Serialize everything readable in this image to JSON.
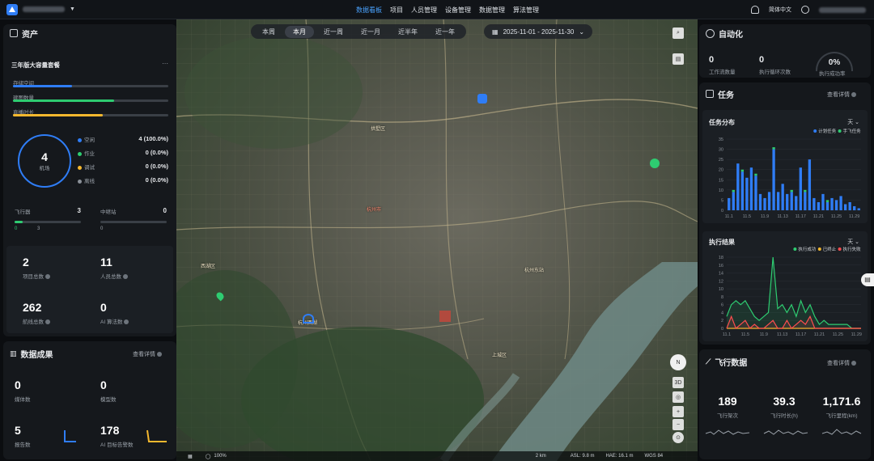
{
  "nav": {
    "items": [
      "数据看板",
      "项目",
      "人员管理",
      "设备管理",
      "数据管理",
      "算法管理"
    ],
    "active_index": 0,
    "language": "简体中文"
  },
  "time_filter": {
    "tabs": [
      "本周",
      "本月",
      "近一周",
      "近一月",
      "近半年",
      "近一年"
    ],
    "active_index": 1,
    "date_range": "2025-11-01 - 2025-11-30"
  },
  "assets": {
    "title": "资产",
    "package_name": "三年版大容量套餐",
    "storage": [
      {
        "label": "存储空间",
        "color": "#2f7df6",
        "fraction": 0.38
      },
      {
        "label": "建图数量",
        "color": "#2ecc71",
        "fraction": 0.65
      },
      {
        "label": "直播时长",
        "color": "#f5b82e",
        "fraction": 0.58
      }
    ],
    "airport_count": "4",
    "airport_label": "机场",
    "status": [
      {
        "label": "空闲",
        "value": "4 (100.0%)",
        "color": "#2f7df6"
      },
      {
        "label": "作业",
        "value": "0 (0.0%)",
        "color": "#2ecc71"
      },
      {
        "label": "调试",
        "value": "0 (0.0%)",
        "color": "#f5b82e"
      },
      {
        "label": "离线",
        "value": "0 (0.0%)",
        "color": "#8a9098"
      }
    ],
    "aircraft_label": "飞行器",
    "aircraft_count": "3",
    "aircraft_online": "0",
    "aircraft_total": "3",
    "relay_label": "中继站",
    "relay_count": "0",
    "relay_online": "0",
    "totals": [
      {
        "value": "2",
        "label": "项目总数"
      },
      {
        "value": "11",
        "label": "人员总数"
      },
      {
        "value": "262",
        "label": "航线总数"
      },
      {
        "value": "0",
        "label": "AI 算法数"
      }
    ]
  },
  "results": {
    "title": "数据成果",
    "more": "查看详情",
    "items": [
      {
        "value": "0",
        "label": "媒体数"
      },
      {
        "value": "0",
        "label": "模型数"
      },
      {
        "value": "5",
        "label": "报告数"
      },
      {
        "value": "178",
        "label": "AI 目标告警数"
      }
    ]
  },
  "automation": {
    "title": "自动化",
    "items": [
      {
        "value": "0",
        "label": "工作流数量"
      },
      {
        "value": "0",
        "label": "执行循环次数"
      }
    ],
    "success_rate": "0%",
    "success_label": "执行成功率"
  },
  "tasks": {
    "title": "任务",
    "more": "查看详情",
    "distribution_title": "任务分布",
    "distribution_unit": "天",
    "result_title": "执行结果",
    "result_unit": "天"
  },
  "flight": {
    "title": "飞行数据",
    "more": "查看详情",
    "items": [
      {
        "value": "189",
        "label": "飞行架次"
      },
      {
        "value": "39.3",
        "label": "飞行时长(h)"
      },
      {
        "value": "1,171.6",
        "label": "飞行里程(km)"
      }
    ]
  },
  "map": {
    "scale": "2 km",
    "asl": "ASL: 9.8 m",
    "hae": "HAE: 16.1 m",
    "datum": "WGS 84",
    "zoom": "100%",
    "tool_3d": "3D",
    "places": [
      {
        "name": "西湖区",
        "red": false
      },
      {
        "name": "杭州市",
        "red": true
      },
      {
        "name": "杭州东站",
        "red": false
      },
      {
        "name": "拱墅区",
        "red": false
      },
      {
        "name": "上城区",
        "red": false
      },
      {
        "name": "杭州西湖",
        "red": false
      }
    ]
  },
  "chart_data": [
    {
      "type": "bar",
      "title": "任务分布",
      "legend": "top-right",
      "categories": [
        "11.1",
        "11.2",
        "11.3",
        "11.4",
        "11.5",
        "11.6",
        "11.7",
        "11.8",
        "11.9",
        "11.10",
        "11.11",
        "11.12",
        "11.13",
        "11.14",
        "11.15",
        "11.16",
        "11.17",
        "11.18",
        "11.19",
        "11.20",
        "11.21",
        "11.22",
        "11.23",
        "11.24",
        "11.25",
        "11.26",
        "11.27",
        "11.28",
        "11.29",
        "11.30"
      ],
      "tick_labels": [
        "11.1",
        "11.5",
        "11.9",
        "11.13",
        "11.17",
        "11.21",
        "11.25",
        "11.29"
      ],
      "ylim": [
        0,
        35
      ],
      "yticks": [
        0,
        5,
        10,
        15,
        20,
        25,
        30,
        35
      ],
      "series": [
        {
          "name": "计划任务",
          "color": "#2f7df6",
          "values": [
            6,
            9,
            23,
            19,
            16,
            21,
            17,
            8,
            6,
            9,
            30,
            9,
            13,
            8,
            9,
            7,
            21,
            9,
            25,
            6,
            4,
            8,
            4,
            6,
            5,
            7,
            3,
            4,
            2,
            1
          ]
        },
        {
          "name": "手飞任务",
          "color": "#2ecc71",
          "values": [
            0,
            1,
            0,
            1,
            0,
            0,
            1,
            0,
            0,
            0,
            1,
            0,
            0,
            0,
            1,
            0,
            0,
            1,
            0,
            0,
            0,
            0,
            1,
            0,
            0,
            0,
            0,
            0,
            0,
            0
          ]
        }
      ]
    },
    {
      "type": "line",
      "title": "执行结果",
      "legend": "top-right",
      "x": [
        "11.1",
        "11.2",
        "11.3",
        "11.4",
        "11.5",
        "11.6",
        "11.7",
        "11.8",
        "11.9",
        "11.10",
        "11.11",
        "11.12",
        "11.13",
        "11.14",
        "11.15",
        "11.16",
        "11.17",
        "11.18",
        "11.19",
        "11.20",
        "11.21",
        "11.22",
        "11.23",
        "11.24",
        "11.25",
        "11.26",
        "11.27",
        "11.28",
        "11.29",
        "11.30"
      ],
      "tick_labels": [
        "11.1",
        "11.5",
        "11.9",
        "11.13",
        "11.17",
        "11.21",
        "11.25",
        "11.29"
      ],
      "ylim": [
        0,
        18
      ],
      "yticks": [
        0,
        2,
        4,
        6,
        8,
        10,
        12,
        14,
        16,
        18
      ],
      "series": [
        {
          "name": "执行成功",
          "color": "#2ecc71",
          "values": [
            3,
            6,
            7,
            6,
            7,
            5,
            3,
            2,
            3,
            4,
            18,
            5,
            6,
            4,
            6,
            3,
            7,
            4,
            6,
            3,
            1,
            2,
            1,
            1,
            1,
            1,
            1,
            0,
            0,
            0
          ]
        },
        {
          "name": "已终止",
          "color": "#f5b82e",
          "values": [
            0,
            0,
            0,
            0,
            0,
            0,
            0,
            0,
            0,
            0,
            0,
            0,
            0,
            0,
            0,
            0,
            0,
            0,
            0,
            0,
            0,
            0,
            0,
            0,
            0,
            0,
            0,
            0,
            0,
            0
          ]
        },
        {
          "name": "执行失败",
          "color": "#ff4d4f",
          "values": [
            0,
            3,
            0,
            1,
            2,
            0,
            1,
            0,
            0,
            1,
            2,
            0,
            0,
            2,
            0,
            1,
            2,
            1,
            3,
            0,
            0,
            0,
            0,
            0,
            0,
            0,
            0,
            0,
            0,
            0
          ]
        }
      ]
    }
  ]
}
